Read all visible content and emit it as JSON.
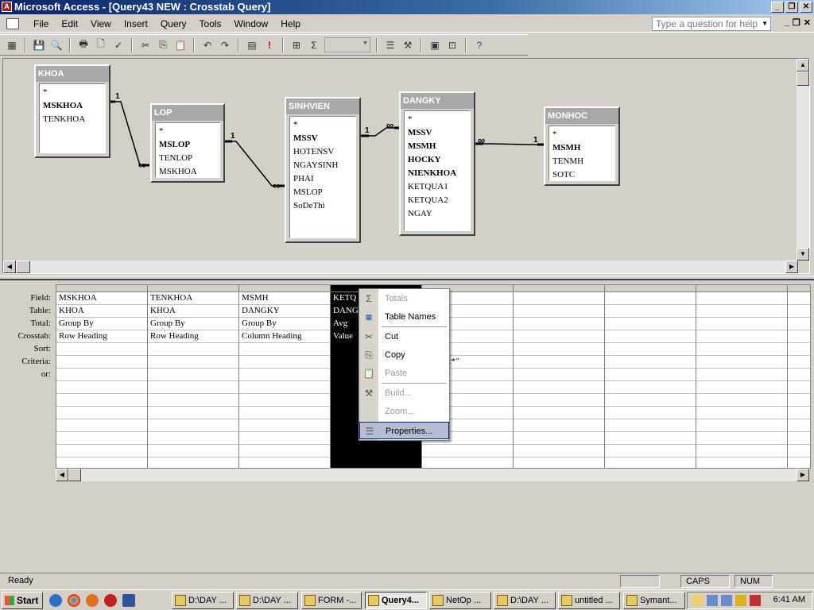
{
  "window": {
    "title": "Microsoft Access - [Query43 NEW : Crosstab Query]",
    "help_placeholder": "Type a question for help"
  },
  "menu": [
    "File",
    "Edit",
    "View",
    "Insert",
    "Query",
    "Tools",
    "Window",
    "Help"
  ],
  "tables": [
    {
      "name": "KHOA",
      "fields": [
        {
          "t": "*",
          "pk": false
        },
        {
          "t": "MSKHOA",
          "pk": true
        },
        {
          "t": "TENKHOA",
          "pk": false
        }
      ]
    },
    {
      "name": "LOP",
      "fields": [
        {
          "t": "*",
          "pk": false
        },
        {
          "t": "MSLOP",
          "pk": true
        },
        {
          "t": "TENLOP",
          "pk": false
        },
        {
          "t": "MSKHOA",
          "pk": false
        }
      ]
    },
    {
      "name": "SINHVIEN",
      "fields": [
        {
          "t": "*",
          "pk": false
        },
        {
          "t": "MSSV",
          "pk": true
        },
        {
          "t": "HOTENSV",
          "pk": false
        },
        {
          "t": "NGAYSINH",
          "pk": false
        },
        {
          "t": "PHAI",
          "pk": false
        },
        {
          "t": "MSLOP",
          "pk": false
        },
        {
          "t": "SoDeThi",
          "pk": false
        }
      ]
    },
    {
      "name": "DANGKY",
      "fields": [
        {
          "t": "*",
          "pk": false
        },
        {
          "t": "MSSV",
          "pk": true
        },
        {
          "t": "MSMH",
          "pk": true
        },
        {
          "t": "HOCKY",
          "pk": true
        },
        {
          "t": "NIENKHOA",
          "pk": true
        },
        {
          "t": "KETQUA1",
          "pk": false
        },
        {
          "t": "KETQUA2",
          "pk": false
        },
        {
          "t": "NGAY",
          "pk": false
        }
      ]
    },
    {
      "name": "MONHOC",
      "fields": [
        {
          "t": "*",
          "pk": false
        },
        {
          "t": "MSMH",
          "pk": true
        },
        {
          "t": "TENMH",
          "pk": false
        },
        {
          "t": "SOTC",
          "pk": false
        }
      ]
    }
  ],
  "joins": {
    "one": "1",
    "many": "∞"
  },
  "grid": {
    "row_labels": [
      "Field:",
      "Table:",
      "Total:",
      "Crosstab:",
      "Sort:",
      "Criteria:",
      "or:"
    ],
    "columns": [
      {
        "field": "MSKHOA",
        "table": "KHOA",
        "total": "Group By",
        "crosstab": "Row Heading",
        "criteria": ""
      },
      {
        "field": "TENKHOA",
        "table": "KHOA",
        "total": "Group By",
        "crosstab": "Row Heading",
        "criteria": ""
      },
      {
        "field": "MSMH",
        "table": "DANGKY",
        "total": "Group By",
        "crosstab": "Column Heading",
        "criteria": ""
      },
      {
        "field": "KETQ",
        "table": "DANG",
        "total": "Avg",
        "crosstab": "Value",
        "criteria": ""
      },
      {
        "field": "H",
        "table": "OC",
        "total": "",
        "crosstab": "",
        "criteria": "Tin hoc*\""
      },
      {
        "field": "",
        "table": "",
        "total": "",
        "crosstab": "",
        "criteria": ""
      },
      {
        "field": "",
        "table": "",
        "total": "",
        "crosstab": "",
        "criteria": ""
      },
      {
        "field": "",
        "table": "",
        "total": "",
        "crosstab": "",
        "criteria": ""
      },
      {
        "field": "",
        "table": "",
        "total": "",
        "crosstab": "",
        "criteria": ""
      }
    ]
  },
  "context_menu": {
    "totals": "Totals",
    "table_names": "Table Names",
    "cut": "Cut",
    "copy": "Copy",
    "paste": "Paste",
    "build": "Build...",
    "zoom": "Zoom...",
    "properties": "Properties..."
  },
  "status": {
    "text": "Ready",
    "caps": "CAPS",
    "num": "NUM"
  },
  "taskbar": {
    "start": "Start",
    "buttons": [
      "D:\\DAY ...",
      "D:\\DAY ...",
      "FORM -...",
      "Query4...",
      "NetOp ...",
      "D:\\DAY ...",
      "untitled ...",
      "Symant..."
    ],
    "active_index": 3,
    "clock": "6:41 AM"
  }
}
